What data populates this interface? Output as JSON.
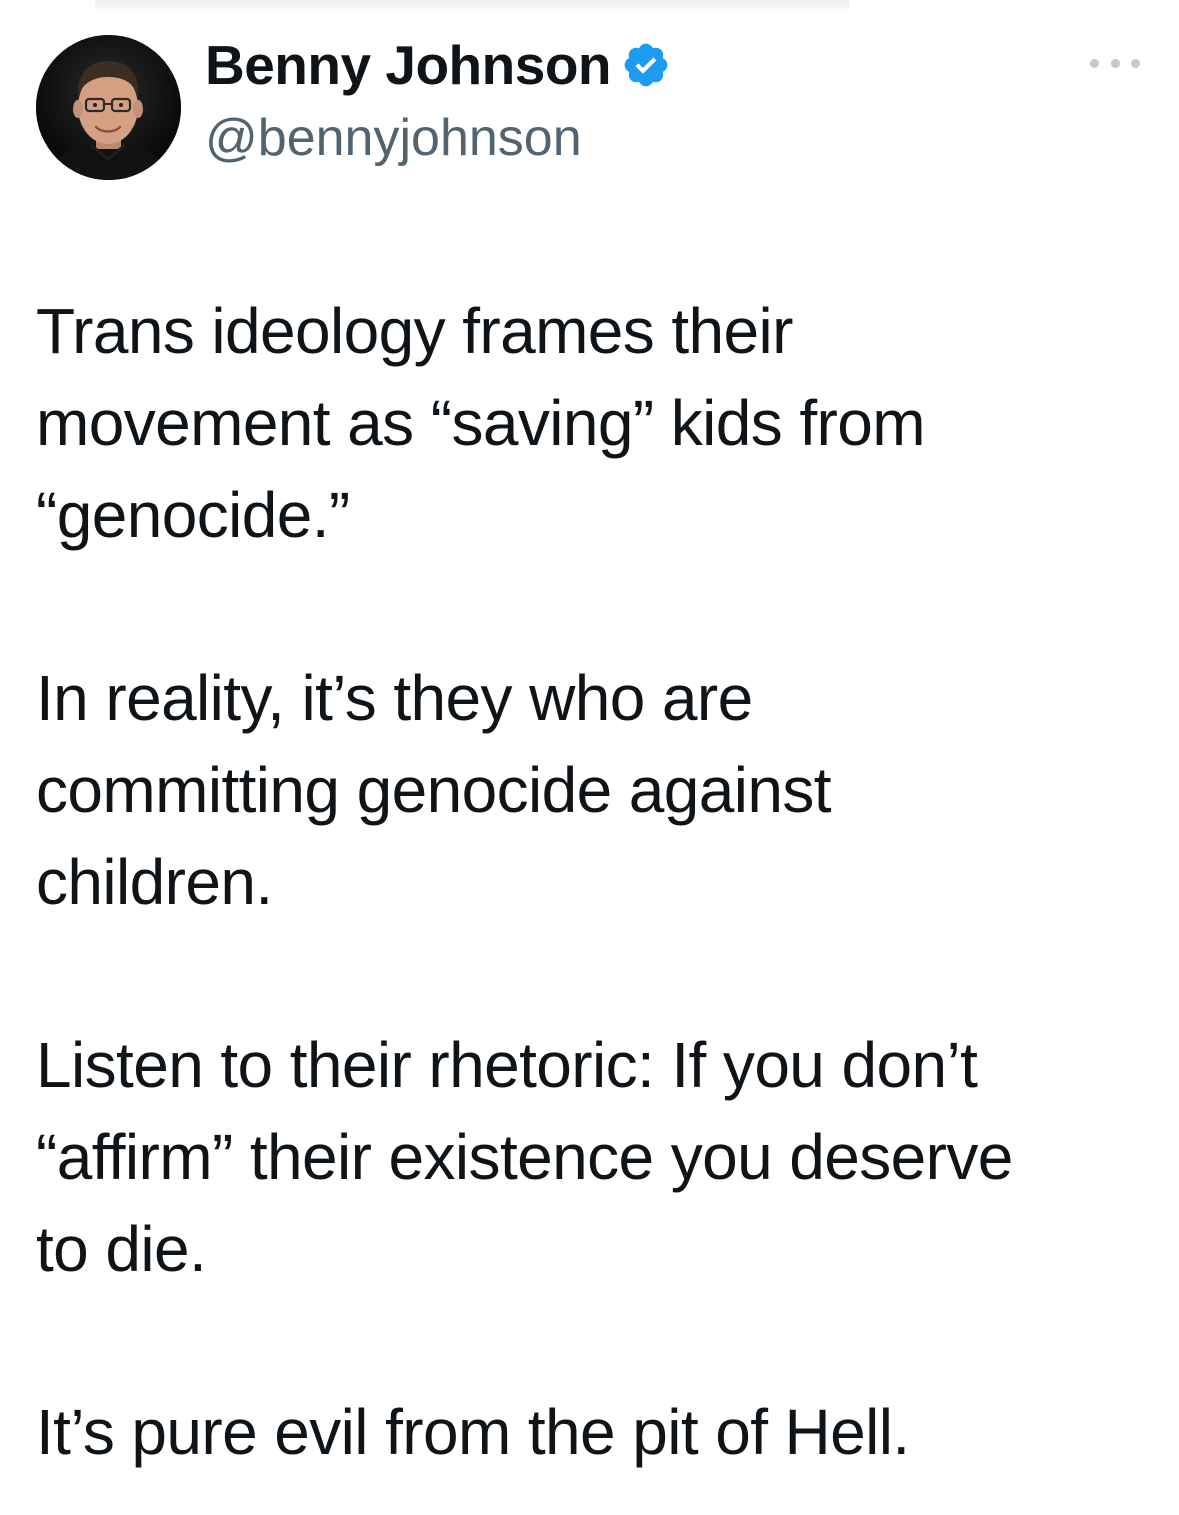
{
  "tweet": {
    "author": {
      "display_name": "Benny Johnson",
      "handle": "@bennyjohnson",
      "verified": true,
      "verified_icon": "verified-badge-icon",
      "verified_color": "#1d9bf0"
    },
    "more_icon": "ellipsis-icon",
    "paragraphs": [
      "Trans ideology frames their\nmovement as “saving” kids from\n“genocide.”",
      "In reality, it’s they who are\ncommitting genocide against\nchildren.",
      "Listen to their rhetoric: If you don’t\n“affirm” their existence you deserve\nto die.",
      "It’s pure evil from the pit of Hell."
    ]
  },
  "colors": {
    "text_primary": "#0f1419",
    "text_secondary": "#536471",
    "background": "#ffffff"
  }
}
